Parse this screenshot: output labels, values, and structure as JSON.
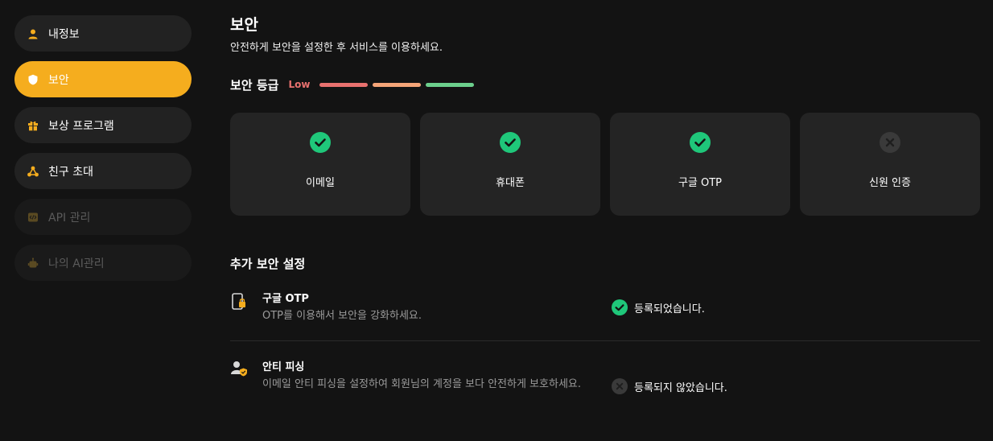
{
  "sidebar": {
    "items": [
      {
        "label": "내정보",
        "icon": "user-icon"
      },
      {
        "label": "보안",
        "icon": "shield-icon"
      },
      {
        "label": "보상 프로그램",
        "icon": "gift-icon"
      },
      {
        "label": "친구 초대",
        "icon": "share-icon"
      },
      {
        "label": "API 관리",
        "icon": "code-icon"
      },
      {
        "label": "나의 AI관리",
        "icon": "robot-icon"
      }
    ]
  },
  "main": {
    "title": "보안",
    "subtitle": "안전하게 보안을 설정한 후 서비스를 이용하세요.",
    "level": {
      "label": "보안 등급",
      "value": "Low",
      "bar_colors": [
        "#e9716f",
        "#f5a578",
        "#6ccf8c"
      ]
    },
    "cards": [
      {
        "label": "이메일",
        "status": "done"
      },
      {
        "label": "휴대폰",
        "status": "done"
      },
      {
        "label": "구글 OTP",
        "status": "done"
      },
      {
        "label": "신원 인증",
        "status": "none"
      }
    ],
    "extra": {
      "title": "추가 보안 설정",
      "settings": [
        {
          "name": "구글 OTP",
          "desc": "OTP를 이용해서 보안을 강화하세요.",
          "status_label": "등록되었습니다."
        },
        {
          "name": "안티 피싱",
          "desc": "이메일 안티 피싱을 설정하여 회원님의 계정을 보다 안전하게 보호하세요.",
          "status_label": "등록되지 않았습니다."
        }
      ]
    }
  },
  "colors": {
    "accent": "#f5ad1e",
    "success": "#1fc77a",
    "low": "#e9716f"
  }
}
